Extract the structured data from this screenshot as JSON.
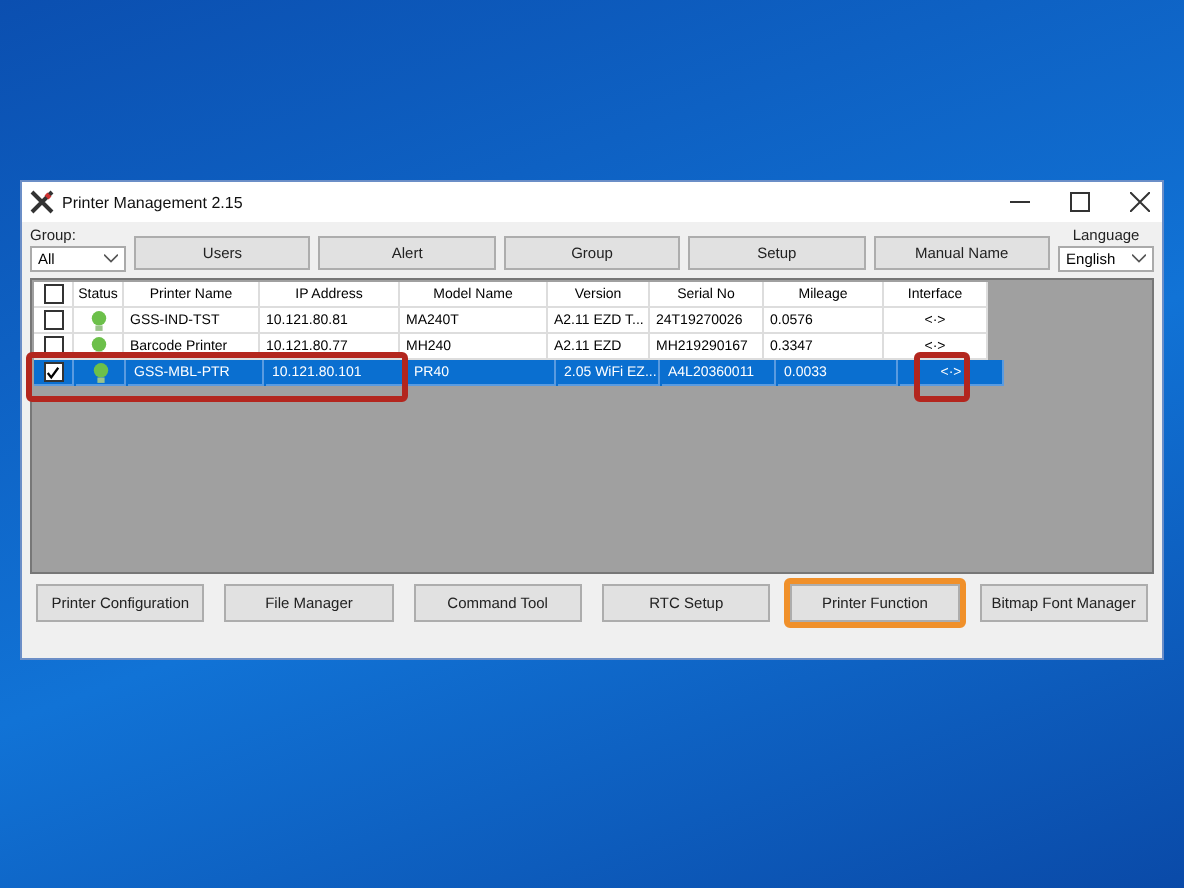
{
  "window": {
    "title": "Printer Management 2.15"
  },
  "group": {
    "label": "Group:",
    "value": "All"
  },
  "toolbar_buttons": [
    "Users",
    "Alert",
    "Group",
    "Setup",
    "Manual Name"
  ],
  "language": {
    "label": "Language",
    "value": "English"
  },
  "table": {
    "columns": [
      "Status",
      "Printer Name",
      "IP Address",
      "Model Name",
      "Version",
      "Serial No",
      "Mileage",
      "Interface"
    ],
    "header_checked": false,
    "rows": [
      {
        "checked": false,
        "selected": false,
        "highlighted": false,
        "interface_highlighted": false,
        "name": "GSS-IND-TST",
        "ip": "10.121.80.81",
        "model": "MA240T",
        "version": "A2.11 EZD T...",
        "serial": "24T19270026",
        "mileage": "0.0576",
        "interface": "<·>"
      },
      {
        "checked": false,
        "selected": false,
        "highlighted": false,
        "interface_highlighted": false,
        "name": "Barcode Printer",
        "ip": "10.121.80.77",
        "model": "MH240",
        "version": "A2.11 EZD",
        "serial": "MH219290167",
        "mileage": "0.3347",
        "interface": "<·>"
      },
      {
        "checked": true,
        "selected": true,
        "highlighted": true,
        "interface_highlighted": true,
        "name": "GSS-MBL-PTR",
        "ip": "10.121.80.101",
        "model": "PR40",
        "version": "2.05 WiFi EZ...",
        "serial": "A4L20360011",
        "mileage": "0.0033",
        "interface": "<·>"
      }
    ]
  },
  "bottom_buttons": [
    {
      "label": "Printer Configuration",
      "highlighted": false
    },
    {
      "label": "File Manager",
      "highlighted": false
    },
    {
      "label": "Command Tool",
      "highlighted": false
    },
    {
      "label": "RTC Setup",
      "highlighted": false
    },
    {
      "label": "Printer Function",
      "highlighted": true
    },
    {
      "label": "Bitmap Font Manager",
      "highlighted": false
    }
  ]
}
